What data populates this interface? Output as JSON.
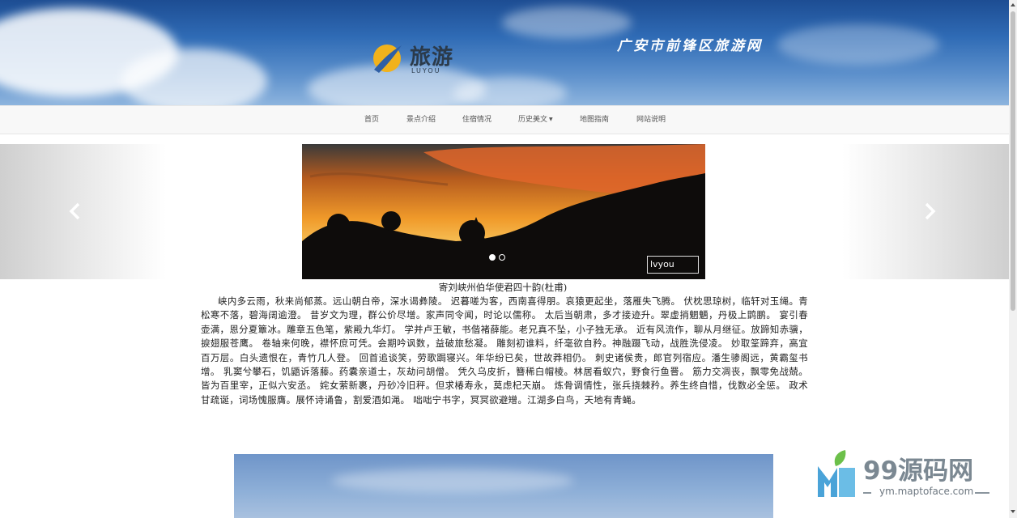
{
  "header": {
    "logo_text": "旅游",
    "logo_subtext": "LUYOU",
    "site_title": "广安市前锋区旅游网"
  },
  "nav": {
    "items": [
      {
        "label": "首页"
      },
      {
        "label": "景点介绍"
      },
      {
        "label": "住宿情况"
      },
      {
        "label": "历史美文"
      },
      {
        "label": "地图指南"
      },
      {
        "label": "网站说明"
      }
    ]
  },
  "carousel": {
    "slide_count": 2,
    "active_index": 0,
    "slide_watermark": "lvyou"
  },
  "article": {
    "title": "寄刘峡州伯华使君四十韵(杜甫)",
    "body": "峡内多云雨，秋来尚郁蒸。远山朝白帝，深水谒彝陵。 迟暮嗟为客，西南喜得朋。哀猿更起坐，落雁失飞腾。 伏枕思琼树，临轩对玉绳。青松寒不落，碧海阔逾澄。 昔岁文为理，群公价尽增。家声同令闻，时论以儒称。 太后当朝肃，多才接迹升。翠虚捎魍魉，丹极上鹍鹏。 宴引春壶满，恩分夏簟冰。雕章五色笔，紫殿九华灯。 学并卢王敏，书偕褚薛能。老兄真不坠，小子独无承。 近有风流作，聊从月继征。放蹄知赤骥，捩翅服苍鹰。 卷轴来何晚，襟怀庶可凭。会期吟讽数，益破旅愁凝。 雕刻初谁料，纤毫欲自矜。神融蹑飞动，战胜洗侵凌。 妙取筌蹄弃，高宜百万层。白头遗恨在，青竹几人登。 回首追谈笑，劳歌跼寝兴。年华纷已矣，世故莽相仍。 刺史诸侯贵，郎官列宿应。潘生骖阁远，黄霸玺书增。 乳窦兮攀石，饥鼯诉落藤。药囊亲道士，灰劫问胡僧。 凭久乌皮折，簪稀白帽棱。林居看蚁穴，野食行鱼罾。 筋力交凋丧，飘零免战兢。皆为百里宰，正似六安丞。 姹女萦新裹，丹砂冷旧秤。但求椿寿永，莫虑杞天崩。 炼骨调情性，张兵挠棘矜。养生终自惜，伐数必全惩。 政术甘疏诞，词场愧服膺。展怀诗诵鲁，割爱酒如渑。 咄咄宁书字，冥冥欲避矰。江湖多白鸟，天地有青蝇。"
  },
  "watermark": {
    "title": "99源码网",
    "url": "ym.maptoface.com"
  },
  "colors": {
    "nav_background": "#f8f8f8",
    "nav_text": "#555555",
    "banner_sky": "#2f6bb5",
    "body_text": "#222222"
  }
}
